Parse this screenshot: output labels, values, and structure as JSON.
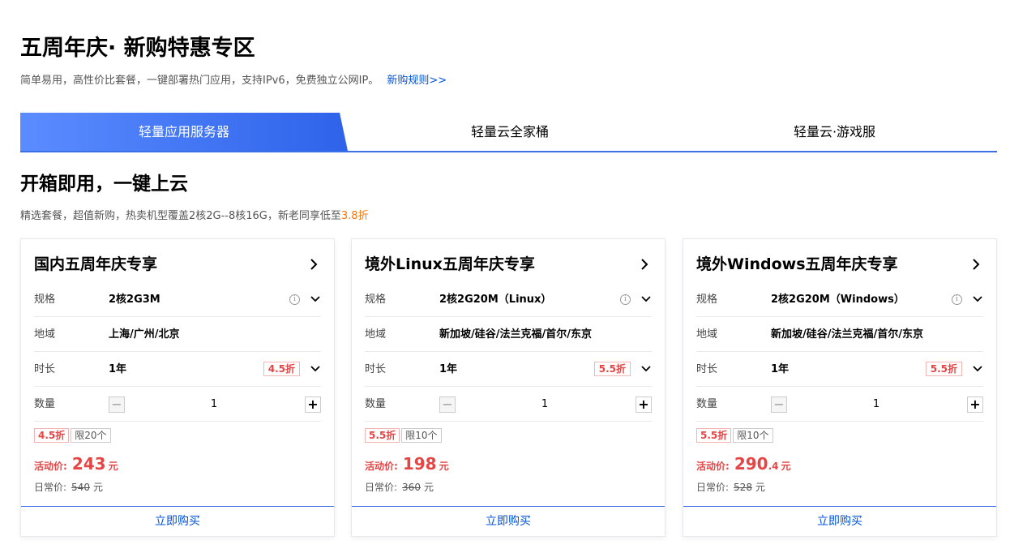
{
  "header": {
    "title": "五周年庆· 新购特惠专区",
    "subtitle": "简单易用，高性价比套餐，一键部署热门应用，支持IPv6，免费独立公网IP。",
    "rule_link": "新购规则>>"
  },
  "tabs": [
    {
      "label": "轻量应用服务器",
      "active": true
    },
    {
      "label": "轻量云全家桶",
      "active": false
    },
    {
      "label": "轻量云·游戏服",
      "active": false
    }
  ],
  "section": {
    "title": "开箱即用，一键上云",
    "subtitle": "精选套餐，超值新购，热卖机型覆盖2核2G--8核16G，新老同享低至",
    "highlight": "3.8折"
  },
  "labels": {
    "spec": "规格",
    "region": "地域",
    "duration": "时长",
    "quantity": "数量",
    "activity_price": "活动价:",
    "regular_price": "日常价:",
    "unit": "元",
    "buy": "立即购买",
    "minus": "−",
    "plus": "+",
    "info": "i"
  },
  "cards": [
    {
      "title": "国内五周年庆专享",
      "spec": "2核2G3M",
      "region": "上海/广州/北京",
      "duration": "1年",
      "discount": "4.5折",
      "quantity": "1",
      "tag_discount": "4.5折",
      "tag_limit": "限20个",
      "price_int": "243",
      "price_dec": "",
      "original_price": "540"
    },
    {
      "title": "境外Linux五周年庆专享",
      "spec": "2核2G20M（Linux）",
      "region": "新加坡/硅谷/法兰克福/首尔/东京",
      "duration": "1年",
      "discount": "5.5折",
      "quantity": "1",
      "tag_discount": "5.5折",
      "tag_limit": "限10个",
      "price_int": "198",
      "price_dec": "",
      "original_price": "360"
    },
    {
      "title": "境外Windows五周年庆专享",
      "spec": "2核2G20M（Windows）",
      "region": "新加坡/硅谷/法兰克福/首尔/东京",
      "duration": "1年",
      "discount": "5.5折",
      "quantity": "1",
      "tag_discount": "5.5折",
      "tag_limit": "限10个",
      "price_int": "290",
      "price_dec": ".4",
      "original_price": "528"
    }
  ],
  "colors": {
    "accent": "#0052d9",
    "tab_gradient_start": "#5b8cff",
    "tab_gradient_end": "#2e63ea",
    "price_red": "#e54545",
    "highlight_orange": "#ff7200"
  }
}
